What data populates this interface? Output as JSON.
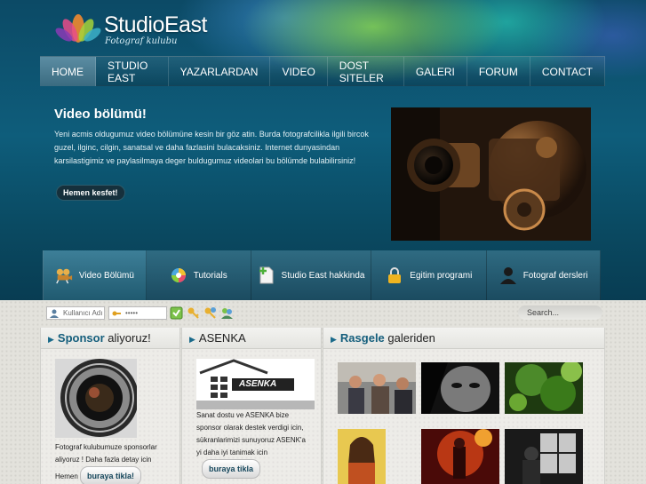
{
  "brand": {
    "title": "StudioEast",
    "subtitle": "Fotograf kulubu"
  },
  "nav": {
    "items": [
      {
        "label": "HOME"
      },
      {
        "label": "STUDIO EAST"
      },
      {
        "label": "YAZARLARDAN"
      },
      {
        "label": "VIDEO"
      },
      {
        "label": "DOST SITELER"
      },
      {
        "label": "GALERI"
      },
      {
        "label": "FORUM"
      },
      {
        "label": "CONTACT"
      }
    ]
  },
  "hero": {
    "title": "Video bölümü!",
    "text": "Yeni acmis oldugumuz video bölümüne kesin bir göz atin. Burda fotografcilikla ilgili bircok guzel, ilginc, cilgin, sanatsal ve daha fazlasini bulacaksiniz. Internet dunyasindan karsilastigimiz ve paylasilmaya deger buldugumuz videolari bu bölümde bulabilirsiniz!",
    "button": "Hemen kesfet!"
  },
  "tabs": [
    {
      "label": "Video Bölümü",
      "icon": "film-projector-icon"
    },
    {
      "label": "Tutorials",
      "icon": "color-wheel-icon"
    },
    {
      "label": "Studio East hakkinda",
      "icon": "document-add-icon"
    },
    {
      "label": "Egitim programi",
      "icon": "lock-icon"
    },
    {
      "label": "Fotograf dersleri",
      "icon": "person-icon"
    }
  ],
  "login": {
    "username_placeholder": "Kullanıcı Adı",
    "password_value": "•••••"
  },
  "search": {
    "placeholder": "Search..."
  },
  "sponsor": {
    "title_hl": "Sponsor",
    "title_rest": " aliyoruz!",
    "text": "Fotograf kulubumuze sponsorlar aliyoruz ! Daha fazla detay icin",
    "text_end": "Hemen",
    "button": "buraya tikla!"
  },
  "asenka": {
    "title": "ASENKA",
    "logo_text": "ASENKA",
    "text": "Sanat dostu ve ASENKA bize sponsor olarak destek verdigi icin, sükranlarimizi sunuyoruz ASENK'a yi daha iyi tanimak icin",
    "button": "buraya tikla"
  },
  "gallery": {
    "title_hl": "Rasgele",
    "title_rest": " galeriden"
  },
  "colors": {
    "accent": "#145e7c",
    "nav_active": "#4a7c92",
    "header_bg": "#0c4a66"
  }
}
